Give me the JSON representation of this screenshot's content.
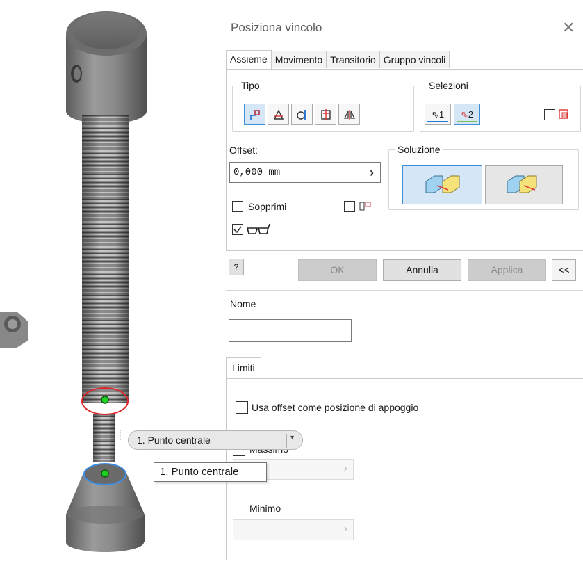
{
  "dialog": {
    "title": "Posiziona vincolo",
    "tabs": [
      {
        "label": "Assieme",
        "active": true
      },
      {
        "label": "Movimento",
        "active": false
      },
      {
        "label": "Transitorio",
        "active": false
      },
      {
        "label": "Gruppo vincoli",
        "active": false
      }
    ],
    "tipo": {
      "label": "Tipo",
      "buttons": [
        "mate-icon",
        "angle-icon",
        "tangent-icon",
        "insert-icon",
        "symmetry-icon"
      ],
      "selected_index": 0
    },
    "selezioni": {
      "label": "Selezioni",
      "sel1": "1",
      "sel2": "2",
      "first_color": "#1f78d1",
      "second_color": "#7cc35a"
    },
    "offset": {
      "label": "Offset:",
      "value": "0,000 mm",
      "arrow": "›"
    },
    "soluzione": {
      "label": "Soluzione",
      "selected_index": 0
    },
    "sopprimi": {
      "label": "Sopprimi",
      "checked": false
    },
    "preview": {
      "checked": true
    },
    "buttons": {
      "help": "?",
      "ok": "OK",
      "annulla": "Annulla",
      "applica": "Applica",
      "collapse": "<<"
    },
    "nome": {
      "label": "Nome",
      "value": ""
    },
    "limiti": {
      "tab_label": "Limiti",
      "usa_offset": "Usa offset come posizione di appoggio",
      "massimo": "Massimo",
      "minimo": "Minimo",
      "field_arrow": "›"
    }
  },
  "viewport": {
    "pill_label": "1. Punto centrale",
    "pill_arrow": "▾",
    "tooltip": "1. Punto centrale",
    "highlight_colors": {
      "red": "#e0262b",
      "blue": "#3a8ee6",
      "green": "#21d121"
    }
  }
}
